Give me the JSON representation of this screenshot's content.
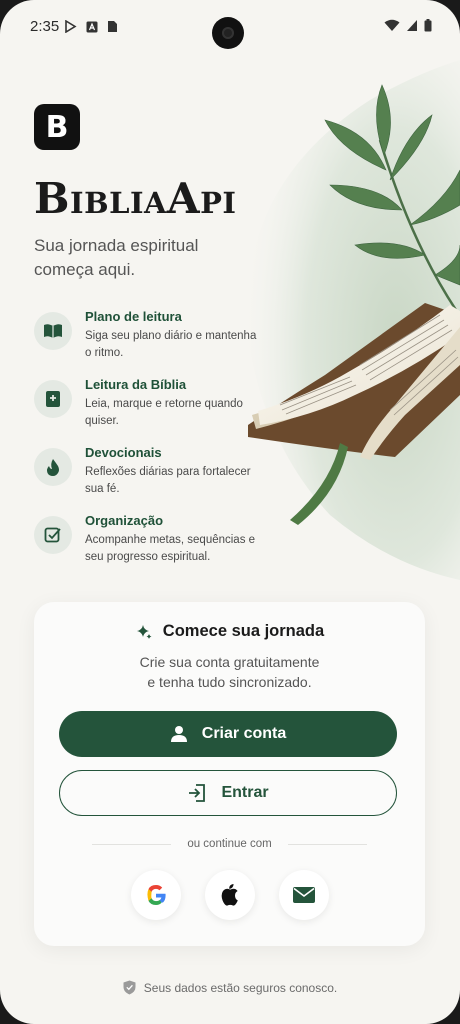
{
  "status_bar": {
    "time": "2:35"
  },
  "app": {
    "logo_letter": "B",
    "name": "BibliaApi",
    "tagline": "Sua jornada espiritual começa aqui."
  },
  "features": [
    {
      "icon": "open-book-icon",
      "title": "Plano de leitura",
      "description": "Siga seu plano diário e mantenha o ritmo."
    },
    {
      "icon": "bible-plus-icon",
      "title": "Leitura da Bíblia",
      "description": "Leia, marque e retorne quando quiser."
    },
    {
      "icon": "flame-icon",
      "title": "Devocionais",
      "description": "Reflexões diárias para fortalecer sua fé."
    },
    {
      "icon": "checkbox-icon",
      "title": "Organização",
      "description": "Acompanhe metas, sequências e seu progresso espiritual."
    }
  ],
  "card": {
    "title": "Comece sua jornada",
    "subtitle_line1": "Crie sua conta gratuitamente",
    "subtitle_line2": "e tenha tudo sincronizado.",
    "create_account_label": "Criar conta",
    "sign_in_label": "Entrar",
    "continue_with": "ou continue com"
  },
  "footer": {
    "secure_text": "Seus dados estão seguros conosco."
  },
  "colors": {
    "accent": "#24543b",
    "background": "#f6f5f1",
    "feature_title": "#1f5138"
  }
}
